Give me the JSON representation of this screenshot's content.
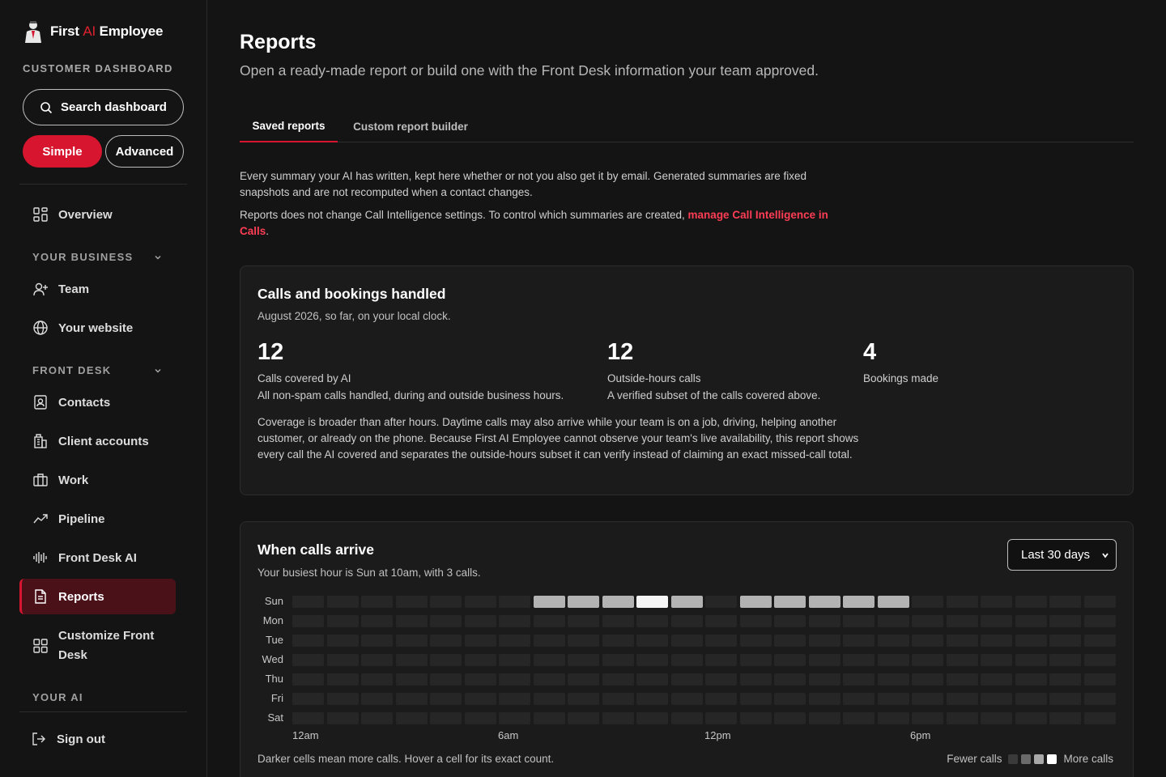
{
  "sidebar": {
    "brand": {
      "first": "First",
      "ai": "AI",
      "employee": "Employee"
    },
    "dashboard_label": "CUSTOMER DASHBOARD",
    "search_label": "Search dashboard",
    "mode_simple": "Simple",
    "mode_advanced": "Advanced",
    "overview": "Overview",
    "section_business": "YOUR BUSINESS",
    "team": "Team",
    "website": "Your website",
    "section_front_desk": "FRONT DESK",
    "contacts": "Contacts",
    "client_accounts": "Client accounts",
    "work": "Work",
    "pipeline": "Pipeline",
    "front_desk_ai": "Front Desk AI",
    "reports": "Reports",
    "customize_front_desk": "Customize Front Desk",
    "section_your_ai": "YOUR AI",
    "sign_out": "Sign out"
  },
  "page": {
    "title": "Reports",
    "subtitle": "Open a ready-made report or build one with the Front Desk information your team approved."
  },
  "tabs": {
    "saved": "Saved reports",
    "builder": "Custom report builder"
  },
  "intro": {
    "p1": "Every summary your AI has written, kept here whether or not you also get it by email. Generated summaries are fixed snapshots and are not recomputed when a contact changes.",
    "p2_prefix": "Reports does not change Call Intelligence settings. To control which summaries are created, ",
    "p2_link": "manage Call Intelligence in Calls",
    "p2_suffix": "."
  },
  "calls_card": {
    "title": "Calls and bookings handled",
    "subtitle": "August 2026, so far, on your local clock.",
    "stats": [
      {
        "value": "12",
        "label": "Calls covered by AI",
        "desc": "All non-spam calls handled, during and outside business hours."
      },
      {
        "value": "12",
        "label": "Outside-hours calls",
        "desc": "A verified subset of the calls covered above."
      },
      {
        "value": "4",
        "label": "Bookings made",
        "desc": ""
      }
    ],
    "coverage_note": "Coverage is broader than after hours. Daytime calls may also arrive while your team is on a job, driving, helping another customer, or already on the phone. Because First AI Employee cannot observe your team's live availability, this report shows every call the AI covered and separates the outside-hours subset it can verify instead of claiming an exact missed-call total."
  },
  "heatmap_card": {
    "title": "When calls arrive",
    "subtitle": "Your busiest hour is Sun at 10am, with 3 calls.",
    "range_selected": "Last 30 days",
    "days": [
      "Sun",
      "Mon",
      "Tue",
      "Wed",
      "Thu",
      "Fri",
      "Sat"
    ],
    "hour_labels": [
      "12am",
      "6am",
      "12pm",
      "6pm"
    ],
    "footnote": "Darker cells mean more calls. Hover a cell for its exact count.",
    "legend_fewer": "Fewer calls",
    "legend_more": "More calls",
    "colors": {
      "empty": "#262626",
      "level1": "#555555",
      "level2": "#8a8a8a",
      "level3": "#b3b3b3",
      "level4": "#f5f5f5"
    },
    "levels": {
      "Sun": [
        0,
        0,
        0,
        0,
        0,
        0,
        0,
        3,
        3,
        3,
        4,
        3,
        0,
        3,
        3,
        3,
        3,
        3,
        0,
        0,
        0,
        0,
        0,
        0
      ],
      "Mon": [
        0,
        0,
        0,
        0,
        0,
        0,
        0,
        0,
        0,
        0,
        0,
        0,
        0,
        0,
        0,
        0,
        0,
        0,
        0,
        0,
        0,
        0,
        0,
        0
      ],
      "Tue": [
        0,
        0,
        0,
        0,
        0,
        0,
        0,
        0,
        0,
        0,
        0,
        0,
        0,
        0,
        0,
        0,
        0,
        0,
        0,
        0,
        0,
        0,
        0,
        0
      ],
      "Wed": [
        0,
        0,
        0,
        0,
        0,
        0,
        0,
        0,
        0,
        0,
        0,
        0,
        0,
        0,
        0,
        0,
        0,
        0,
        0,
        0,
        0,
        0,
        0,
        0
      ],
      "Thu": [
        0,
        0,
        0,
        0,
        0,
        0,
        0,
        0,
        0,
        0,
        0,
        0,
        0,
        0,
        0,
        0,
        0,
        0,
        0,
        0,
        0,
        0,
        0,
        0
      ],
      "Fri": [
        0,
        0,
        0,
        0,
        0,
        0,
        0,
        0,
        0,
        0,
        0,
        0,
        0,
        0,
        0,
        0,
        0,
        0,
        0,
        0,
        0,
        0,
        0,
        0
      ],
      "Sat": [
        0,
        0,
        0,
        0,
        0,
        0,
        0,
        0,
        0,
        0,
        0,
        0,
        0,
        0,
        0,
        0,
        0,
        0,
        0,
        0,
        0,
        0,
        0,
        0
      ]
    }
  },
  "accent": "#d7152e"
}
